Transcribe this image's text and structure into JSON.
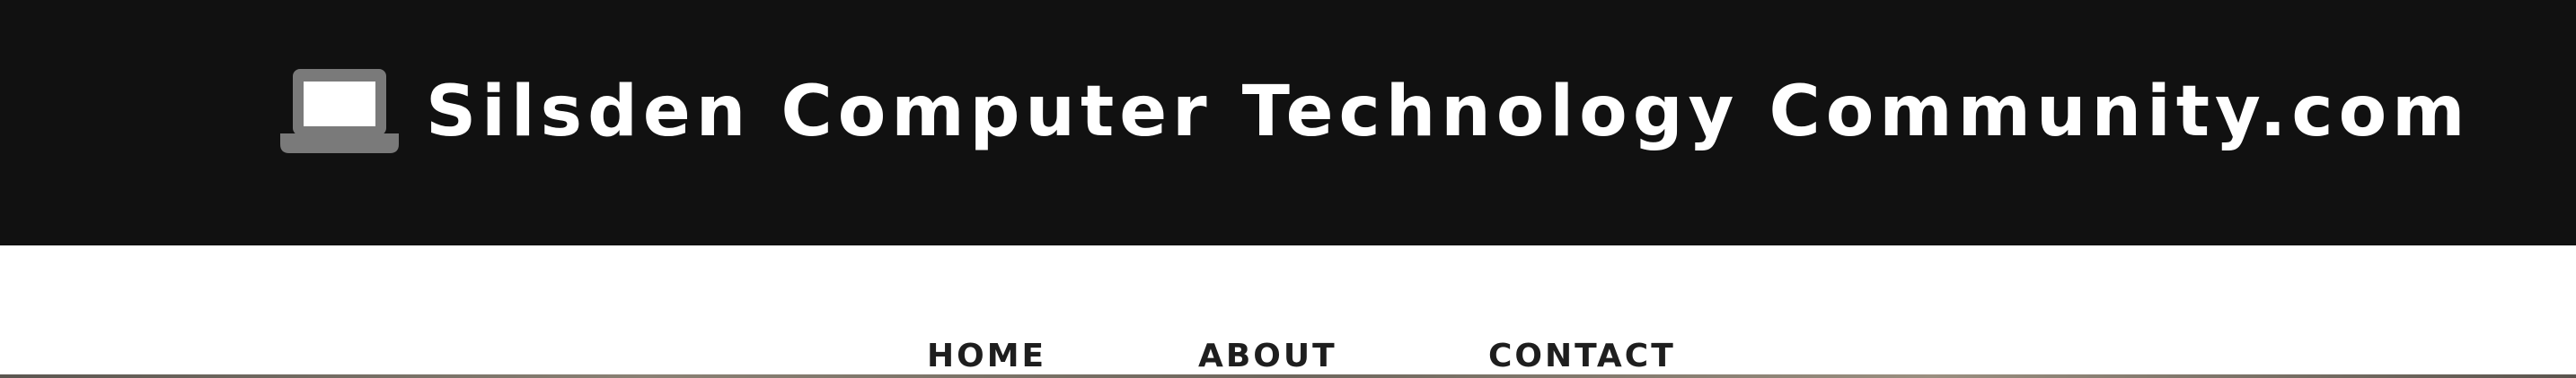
{
  "header": {
    "title": "Silsden Computer Technology Community.com",
    "icon": "laptop-icon",
    "background_color": "#111111",
    "title_color": "#ffffff"
  },
  "nav": {
    "items": [
      {
        "label": "HOME"
      },
      {
        "label": "ABOUT"
      },
      {
        "label": "CONTACT"
      }
    ],
    "text_color": "#1e1e1e"
  }
}
